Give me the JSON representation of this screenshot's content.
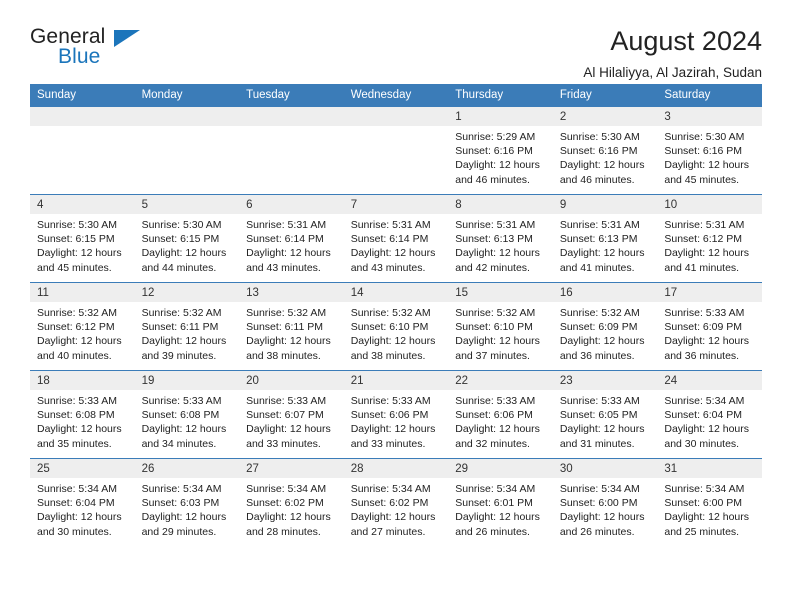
{
  "brand": {
    "name_top": "General",
    "name_bottom": "Blue",
    "accent_color": "#1b75bb"
  },
  "header": {
    "title": "August 2024",
    "subtitle": "Al Hilaliyya, Al Jazirah, Sudan"
  },
  "colors": {
    "header_blue": "#3b7cb8",
    "daynum_gray": "#eeeeee",
    "text": "#222222"
  },
  "weekday_headers": [
    "Sunday",
    "Monday",
    "Tuesday",
    "Wednesday",
    "Thursday",
    "Friday",
    "Saturday"
  ],
  "labels": {
    "sunrise_prefix": "Sunrise: ",
    "sunset_prefix": "Sunset: ",
    "daylight_prefix": "Daylight: "
  },
  "weeks": [
    [
      {
        "day": "",
        "empty": true
      },
      {
        "day": "",
        "empty": true
      },
      {
        "day": "",
        "empty": true
      },
      {
        "day": "",
        "empty": true
      },
      {
        "day": "1",
        "sunrise": "Sunrise: 5:29 AM",
        "sunset": "Sunset: 6:16 PM",
        "daylight_l1": "Daylight: 12 hours",
        "daylight_l2": "and 46 minutes."
      },
      {
        "day": "2",
        "sunrise": "Sunrise: 5:30 AM",
        "sunset": "Sunset: 6:16 PM",
        "daylight_l1": "Daylight: 12 hours",
        "daylight_l2": "and 46 minutes."
      },
      {
        "day": "3",
        "sunrise": "Sunrise: 5:30 AM",
        "sunset": "Sunset: 6:16 PM",
        "daylight_l1": "Daylight: 12 hours",
        "daylight_l2": "and 45 minutes."
      }
    ],
    [
      {
        "day": "4",
        "sunrise": "Sunrise: 5:30 AM",
        "sunset": "Sunset: 6:15 PM",
        "daylight_l1": "Daylight: 12 hours",
        "daylight_l2": "and 45 minutes."
      },
      {
        "day": "5",
        "sunrise": "Sunrise: 5:30 AM",
        "sunset": "Sunset: 6:15 PM",
        "daylight_l1": "Daylight: 12 hours",
        "daylight_l2": "and 44 minutes."
      },
      {
        "day": "6",
        "sunrise": "Sunrise: 5:31 AM",
        "sunset": "Sunset: 6:14 PM",
        "daylight_l1": "Daylight: 12 hours",
        "daylight_l2": "and 43 minutes."
      },
      {
        "day": "7",
        "sunrise": "Sunrise: 5:31 AM",
        "sunset": "Sunset: 6:14 PM",
        "daylight_l1": "Daylight: 12 hours",
        "daylight_l2": "and 43 minutes."
      },
      {
        "day": "8",
        "sunrise": "Sunrise: 5:31 AM",
        "sunset": "Sunset: 6:13 PM",
        "daylight_l1": "Daylight: 12 hours",
        "daylight_l2": "and 42 minutes."
      },
      {
        "day": "9",
        "sunrise": "Sunrise: 5:31 AM",
        "sunset": "Sunset: 6:13 PM",
        "daylight_l1": "Daylight: 12 hours",
        "daylight_l2": "and 41 minutes."
      },
      {
        "day": "10",
        "sunrise": "Sunrise: 5:31 AM",
        "sunset": "Sunset: 6:12 PM",
        "daylight_l1": "Daylight: 12 hours",
        "daylight_l2": "and 41 minutes."
      }
    ],
    [
      {
        "day": "11",
        "sunrise": "Sunrise: 5:32 AM",
        "sunset": "Sunset: 6:12 PM",
        "daylight_l1": "Daylight: 12 hours",
        "daylight_l2": "and 40 minutes."
      },
      {
        "day": "12",
        "sunrise": "Sunrise: 5:32 AM",
        "sunset": "Sunset: 6:11 PM",
        "daylight_l1": "Daylight: 12 hours",
        "daylight_l2": "and 39 minutes."
      },
      {
        "day": "13",
        "sunrise": "Sunrise: 5:32 AM",
        "sunset": "Sunset: 6:11 PM",
        "daylight_l1": "Daylight: 12 hours",
        "daylight_l2": "and 38 minutes."
      },
      {
        "day": "14",
        "sunrise": "Sunrise: 5:32 AM",
        "sunset": "Sunset: 6:10 PM",
        "daylight_l1": "Daylight: 12 hours",
        "daylight_l2": "and 38 minutes."
      },
      {
        "day": "15",
        "sunrise": "Sunrise: 5:32 AM",
        "sunset": "Sunset: 6:10 PM",
        "daylight_l1": "Daylight: 12 hours",
        "daylight_l2": "and 37 minutes."
      },
      {
        "day": "16",
        "sunrise": "Sunrise: 5:32 AM",
        "sunset": "Sunset: 6:09 PM",
        "daylight_l1": "Daylight: 12 hours",
        "daylight_l2": "and 36 minutes."
      },
      {
        "day": "17",
        "sunrise": "Sunrise: 5:33 AM",
        "sunset": "Sunset: 6:09 PM",
        "daylight_l1": "Daylight: 12 hours",
        "daylight_l2": "and 36 minutes."
      }
    ],
    [
      {
        "day": "18",
        "sunrise": "Sunrise: 5:33 AM",
        "sunset": "Sunset: 6:08 PM",
        "daylight_l1": "Daylight: 12 hours",
        "daylight_l2": "and 35 minutes."
      },
      {
        "day": "19",
        "sunrise": "Sunrise: 5:33 AM",
        "sunset": "Sunset: 6:08 PM",
        "daylight_l1": "Daylight: 12 hours",
        "daylight_l2": "and 34 minutes."
      },
      {
        "day": "20",
        "sunrise": "Sunrise: 5:33 AM",
        "sunset": "Sunset: 6:07 PM",
        "daylight_l1": "Daylight: 12 hours",
        "daylight_l2": "and 33 minutes."
      },
      {
        "day": "21",
        "sunrise": "Sunrise: 5:33 AM",
        "sunset": "Sunset: 6:06 PM",
        "daylight_l1": "Daylight: 12 hours",
        "daylight_l2": "and 33 minutes."
      },
      {
        "day": "22",
        "sunrise": "Sunrise: 5:33 AM",
        "sunset": "Sunset: 6:06 PM",
        "daylight_l1": "Daylight: 12 hours",
        "daylight_l2": "and 32 minutes."
      },
      {
        "day": "23",
        "sunrise": "Sunrise: 5:33 AM",
        "sunset": "Sunset: 6:05 PM",
        "daylight_l1": "Daylight: 12 hours",
        "daylight_l2": "and 31 minutes."
      },
      {
        "day": "24",
        "sunrise": "Sunrise: 5:34 AM",
        "sunset": "Sunset: 6:04 PM",
        "daylight_l1": "Daylight: 12 hours",
        "daylight_l2": "and 30 minutes."
      }
    ],
    [
      {
        "day": "25",
        "sunrise": "Sunrise: 5:34 AM",
        "sunset": "Sunset: 6:04 PM",
        "daylight_l1": "Daylight: 12 hours",
        "daylight_l2": "and 30 minutes."
      },
      {
        "day": "26",
        "sunrise": "Sunrise: 5:34 AM",
        "sunset": "Sunset: 6:03 PM",
        "daylight_l1": "Daylight: 12 hours",
        "daylight_l2": "and 29 minutes."
      },
      {
        "day": "27",
        "sunrise": "Sunrise: 5:34 AM",
        "sunset": "Sunset: 6:02 PM",
        "daylight_l1": "Daylight: 12 hours",
        "daylight_l2": "and 28 minutes."
      },
      {
        "day": "28",
        "sunrise": "Sunrise: 5:34 AM",
        "sunset": "Sunset: 6:02 PM",
        "daylight_l1": "Daylight: 12 hours",
        "daylight_l2": "and 27 minutes."
      },
      {
        "day": "29",
        "sunrise": "Sunrise: 5:34 AM",
        "sunset": "Sunset: 6:01 PM",
        "daylight_l1": "Daylight: 12 hours",
        "daylight_l2": "and 26 minutes."
      },
      {
        "day": "30",
        "sunrise": "Sunrise: 5:34 AM",
        "sunset": "Sunset: 6:00 PM",
        "daylight_l1": "Daylight: 12 hours",
        "daylight_l2": "and 26 minutes."
      },
      {
        "day": "31",
        "sunrise": "Sunrise: 5:34 AM",
        "sunset": "Sunset: 6:00 PM",
        "daylight_l1": "Daylight: 12 hours",
        "daylight_l2": "and 25 minutes."
      }
    ]
  ]
}
